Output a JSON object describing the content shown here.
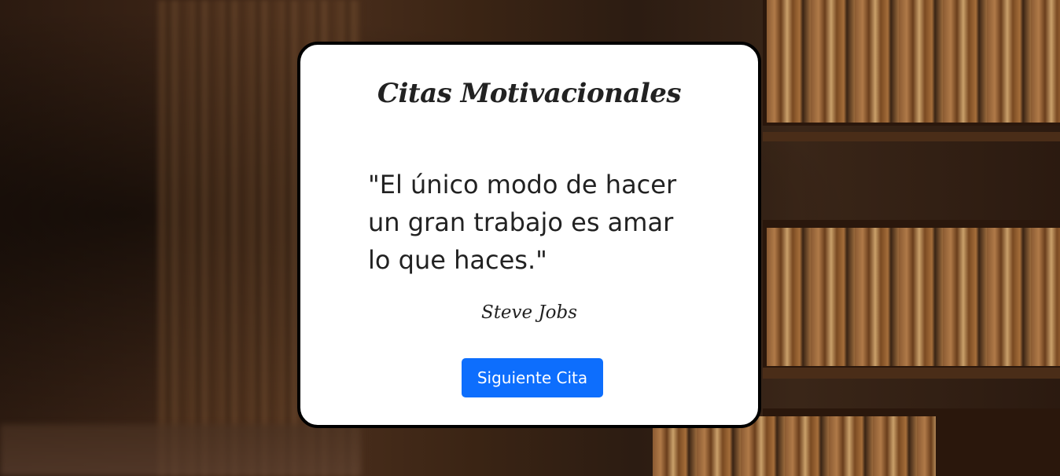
{
  "background": {
    "description_icon": "library-bookshelves-photo"
  },
  "card": {
    "title": "Citas Motivacionales",
    "quote": "\"El único modo de hacer un gran trabajo es amar lo que haces.\"",
    "author": "Steve Jobs",
    "next_button_label": "Siguiente Cita"
  },
  "colors": {
    "button": "#0d6efd",
    "card_border": "#000000",
    "text": "#222222"
  }
}
